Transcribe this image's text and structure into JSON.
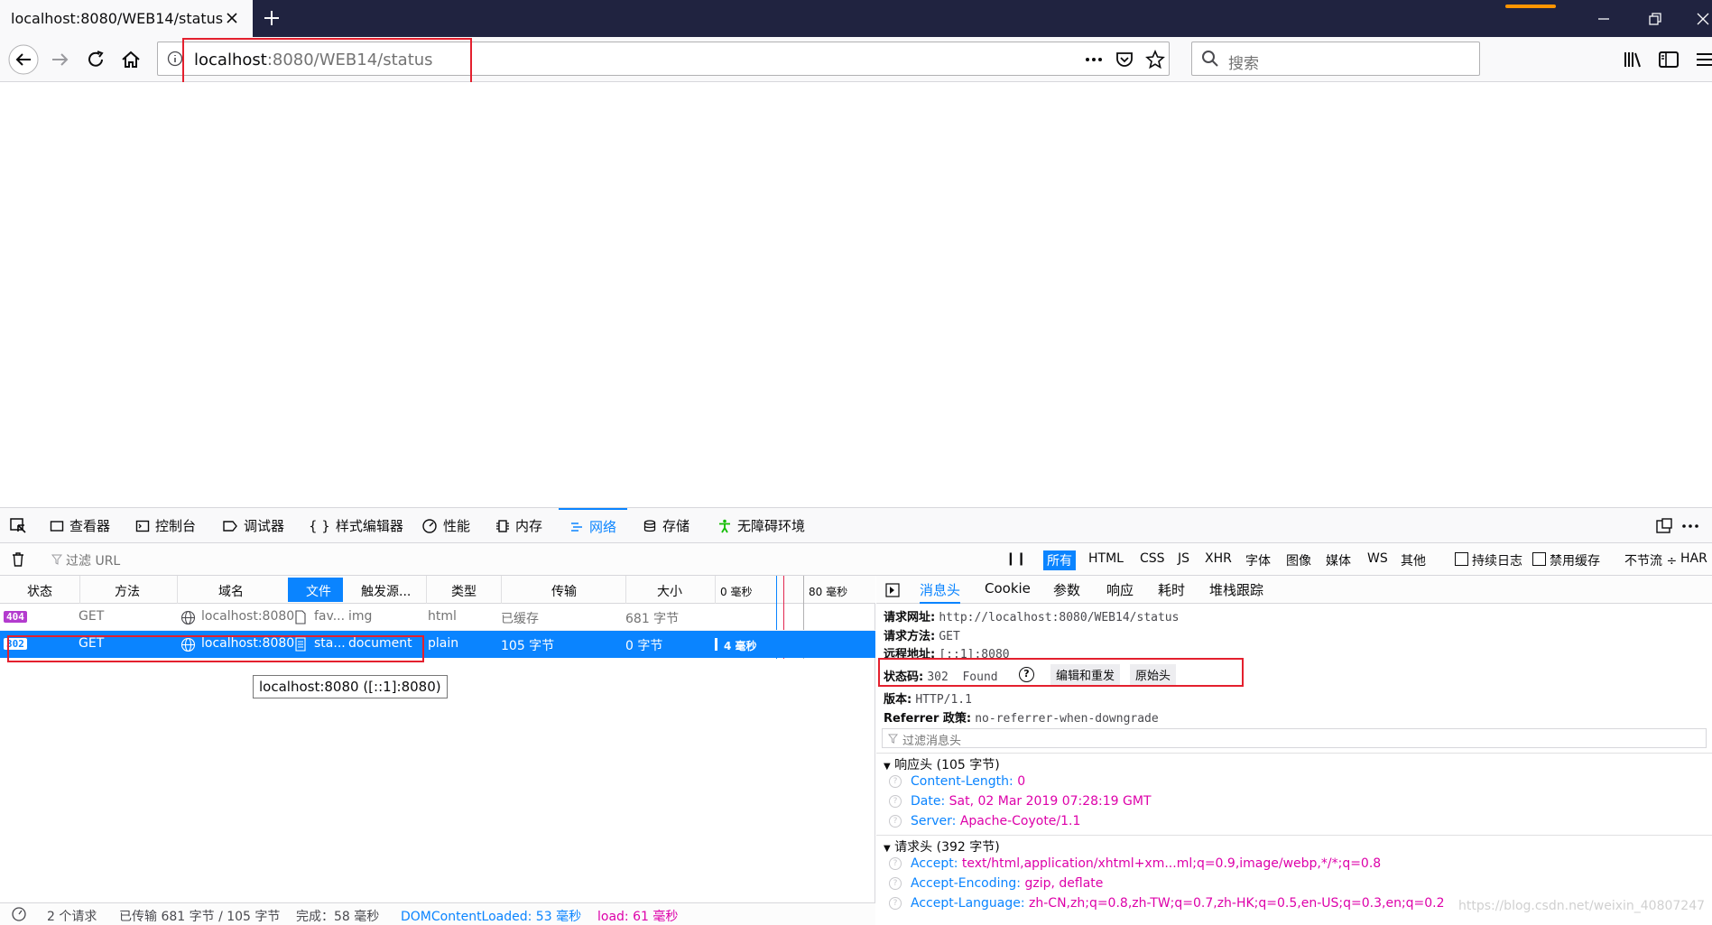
{
  "browser": {
    "tab_title": "localhost:8080/WEB14/status",
    "url_host": "localhost",
    "url_rest": ":8080/WEB14/status",
    "search_placeholder": "搜索"
  },
  "devtools": {
    "tabs": [
      "查看器",
      "控制台",
      "调试器",
      "样式编辑器",
      "性能",
      "内存",
      "网络",
      "存储",
      "无障碍环境"
    ],
    "selected_tab": "网络",
    "filter_url_placeholder": "过滤 URL",
    "type_filters": [
      "所有",
      "HTML",
      "CSS",
      "JS",
      "XHR",
      "字体",
      "图像",
      "媒体",
      "WS",
      "其他"
    ],
    "persist_log": "持续日志",
    "disable_cache": "禁用缓存",
    "throttle": "不节流 ÷",
    "har": "HAR"
  },
  "table": {
    "columns": [
      "状态",
      "方法",
      "域名",
      "文件",
      "触发源...",
      "类型",
      "传输",
      "大小",
      "0 毫秒",
      "80 毫秒"
    ],
    "rows": [
      {
        "status": "404",
        "method": "GET",
        "domain": "localhost:8080",
        "file": "fav...",
        "cause": "img",
        "type": "html",
        "transferred": "已缓存",
        "size": "681 字节",
        "time": ""
      },
      {
        "status": "302",
        "method": "GET",
        "domain": "localhost:8080",
        "file": "sta...",
        "cause": "document",
        "type": "plain",
        "transferred": "105 字节",
        "size": "0 字节",
        "time": "4 毫秒"
      }
    ],
    "tooltip": "localhost:8080 ([::1]:8080)"
  },
  "statusbar": {
    "requests": "2 个请求",
    "transferred": "已传输 681 字节 / 105 字节",
    "finish": "完成：58 毫秒",
    "dom_loaded": "DOMContentLoaded: 53 毫秒",
    "load": "load: 61 毫秒"
  },
  "panel": {
    "tabs": [
      "消息头",
      "Cookie",
      "参数",
      "响应",
      "耗时",
      "堆栈跟踪"
    ],
    "selected": "消息头",
    "request_url_label": "请求网址:",
    "request_url": "http://localhost:8080/WEB14/status",
    "method_label": "请求方法:",
    "method": "GET",
    "remote_label": "远程地址:",
    "remote": "[::1]:8080",
    "status_label": "状态码:",
    "status": "302  Found",
    "edit_resend": "编辑和重发",
    "raw_headers": "原始头",
    "version_label": "版本:",
    "version": "HTTP/1.1",
    "referrer_label": "Referrer 政策:",
    "referrer": "no-referrer-when-downgrade",
    "filter_headers_placeholder": "过滤消息头",
    "response_section": "响应头 (105 字节)",
    "response_headers": [
      {
        "k": "Content-Length:",
        "v": "0"
      },
      {
        "k": "Date:",
        "v": "Sat, 02 Mar 2019 07:28:19 GMT"
      },
      {
        "k": "Server:",
        "v": "Apache-Coyote/1.1"
      }
    ],
    "request_section": "请求头 (392 字节)",
    "request_headers": [
      {
        "k": "Accept:",
        "v": "text/html,application/xhtml+xm...ml;q=0.9,image/webp,*/*;q=0.8"
      },
      {
        "k": "Accept-Encoding:",
        "v": "gzip, deflate"
      },
      {
        "k": "Accept-Language:",
        "v": "zh-CN,zh;q=0.8,zh-TW;q=0.7,zh-HK;q=0.5,en-US;q=0.3,en;q=0.2"
      }
    ]
  },
  "watermark": "https://blog.csdn.net/weixin_40807247",
  "colors": {
    "accent": "#0a84ff",
    "highlight": "#e4202e",
    "header_value": "#dd00a9"
  }
}
